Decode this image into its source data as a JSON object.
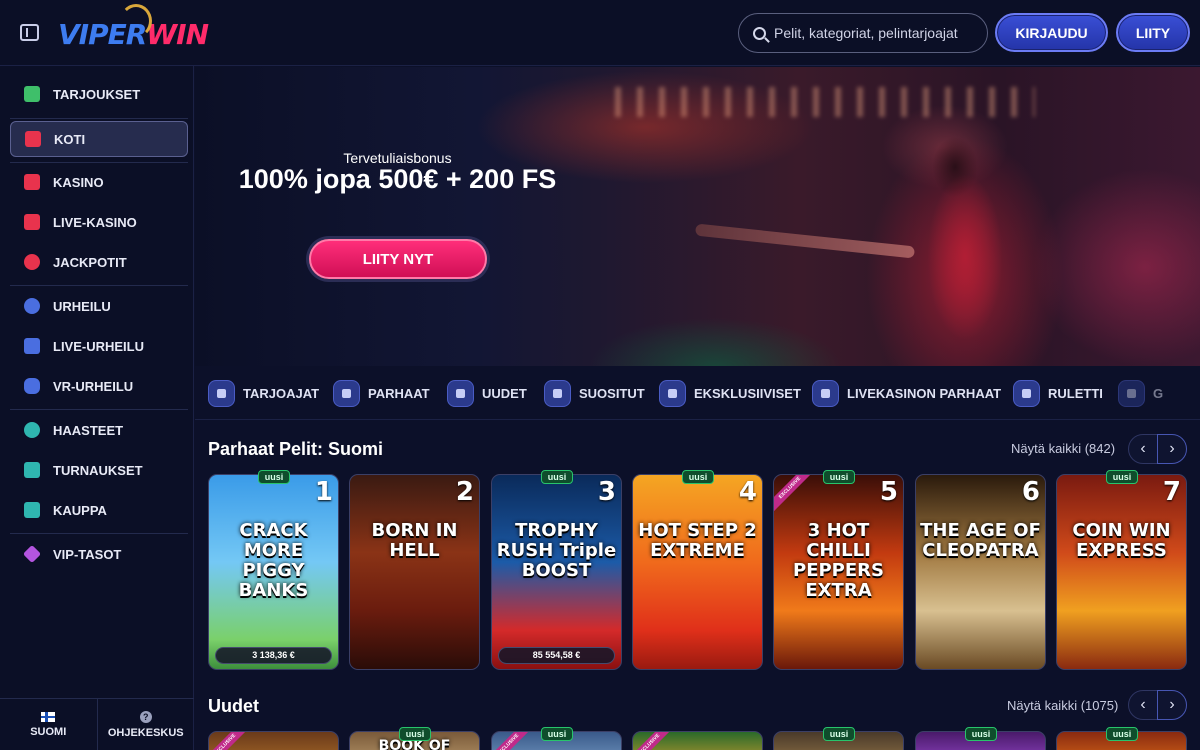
{
  "header": {
    "logo": {
      "part1": "VIPER",
      "part2": "WIN"
    },
    "search_placeholder": "Pelit, kategoriat, pelintarjoajat",
    "login_label": "KIRJAUDU",
    "join_label": "LIITY"
  },
  "sidebar": {
    "items": [
      {
        "label": "TARJOUKSET",
        "icon": "gift-icon",
        "color": "#3fbf6a"
      },
      {
        "label": "KOTI",
        "icon": "home-icon",
        "color": "#e8334d",
        "active": true
      },
      {
        "label": "KASINO",
        "icon": "slot-machine-icon",
        "color": "#e8334d"
      },
      {
        "label": "LIVE-KASINO",
        "icon": "cards-icon",
        "color": "#e8334d"
      },
      {
        "label": "JACKPOTIT",
        "icon": "clover-icon",
        "color": "#e8334d"
      },
      {
        "label": "URHEILU",
        "icon": "ball-icon",
        "color": "#4a6ee0"
      },
      {
        "label": "LIVE-URHEILU",
        "icon": "live-icon",
        "color": "#4a6ee0"
      },
      {
        "label": "VR-URHEILU",
        "icon": "gamepad-icon",
        "color": "#4a6ee0"
      },
      {
        "label": "HAASTEET",
        "icon": "target-icon",
        "color": "#2fb6b0"
      },
      {
        "label": "TURNAUKSET",
        "icon": "trophy-icon",
        "color": "#2fb6b0"
      },
      {
        "label": "KAUPPA",
        "icon": "shop-icon",
        "color": "#2fb6b0"
      },
      {
        "label": "VIP-TASOT",
        "icon": "diamond-icon",
        "color": "#b455e0"
      }
    ],
    "footer": {
      "language": "SUOMI",
      "help": "OHJEKESKUS",
      "help_icon_glyph": "?"
    }
  },
  "hero": {
    "subtitle": "Tervetuliaisbonus",
    "title": "100% jopa 500€ + 200 FS",
    "cta": "LIITY NYT"
  },
  "categories": [
    {
      "label": "TARJOAJAT",
      "icon": "provider-icon"
    },
    {
      "label": "PARHAAT",
      "icon": "star-icon"
    },
    {
      "label": "UUDET",
      "icon": "new-icon"
    },
    {
      "label": "SUOSITUT",
      "icon": "flame-icon"
    },
    {
      "label": "EKSKLUSIIVISET",
      "icon": "diamond-icon"
    },
    {
      "label": "LIVEKASINON PARHAAT",
      "icon": "live-casino-icon"
    },
    {
      "label": "RULETTI",
      "icon": "roulette-icon"
    },
    {
      "label": "G",
      "icon": "more-icon"
    }
  ],
  "top_games": {
    "title": "Parhaat Pelit: Suomi",
    "view_all": "Näytä kaikki (842)",
    "games": [
      {
        "rank": "1",
        "name": "CRACK MORE PIGGY BANKS",
        "badge": "uusi",
        "jackpot": "3 138,36 €",
        "bg": "linear-gradient(#3a9be8 0%, #74c8f5 45%, #7ad06a 85%, #3d8f3c 100%)"
      },
      {
        "rank": "2",
        "name": "BORN IN HELL",
        "badge": "",
        "jackpot": "",
        "bg": "linear-gradient(#3a1a12 0%, #8a3316 40%, #6a1c0e 70%, #2a0c08 100%)"
      },
      {
        "rank": "3",
        "name": "TROPHY RUSH Triple BOOST",
        "badge": "uusi",
        "jackpot": "85 554,58 €",
        "bg": "linear-gradient(#0a2a5a 0%, #1c5ba8 45%, #d42a2a 80%, #8a1010 100%)"
      },
      {
        "rank": "4",
        "name": "HOT STEP 2 EXTREME",
        "badge": "uusi",
        "jackpot": "",
        "bg": "linear-gradient(#f5a623 0%, #f06a1c 45%, #e0301a 80%, #9a1a10 100%)"
      },
      {
        "rank": "5",
        "name": "3 HOT CHILLI PEPPERS EXTRA",
        "badge": "uusi",
        "jackpot": "",
        "bg": "linear-gradient(#3a0e08 0%, #c23a10 40%, #f07a1a 70%, #6a180a 100%)",
        "exclusive": "EXCLUSIVE"
      },
      {
        "rank": "6",
        "name": "THE AGE OF CLEOPATRA",
        "badge": "",
        "jackpot": "",
        "bg": "linear-gradient(#2a1a0c 0%, #a07840 40%, #d8c090 70%, #6a4a24 100%)"
      },
      {
        "rank": "7",
        "name": "COIN WIN EXPRESS",
        "badge": "uusi",
        "jackpot": "",
        "bg": "linear-gradient(#7a1a10 0%, #d04a1a 40%, #f0a020 70%, #8a2a10 100%)"
      }
    ]
  },
  "new_games": {
    "title": "Uudet",
    "view_all": "Näytä kaikki (1075)",
    "games": [
      {
        "name": "",
        "badge": "",
        "bg": "linear-gradient(#6a3a1a, #b0702a)",
        "exclusive": "EXCLUSIVE"
      },
      {
        "name": "BOOK OF",
        "badge": "uusi",
        "bg": "linear-gradient(#7a5a3a, #c0a070)"
      },
      {
        "name": "",
        "badge": "uusi",
        "bg": "linear-gradient(#3a5a8a, #7aa0c8)",
        "exclusive": "EXCLUSIVE"
      },
      {
        "name": "",
        "badge": "",
        "bg": "linear-gradient(#2a6a2a, #d0a030)",
        "exclusive": "EXCLUSIVE"
      },
      {
        "name": "",
        "badge": "uusi",
        "bg": "linear-gradient(#4a3a2a, #9a7a4a)"
      },
      {
        "name": "",
        "badge": "uusi",
        "bg": "linear-gradient(#4a1a6a, #9a4ad0)"
      },
      {
        "name": "",
        "badge": "uusi",
        "bg": "linear-gradient(#8a2a10, #e0701a)"
      }
    ]
  }
}
